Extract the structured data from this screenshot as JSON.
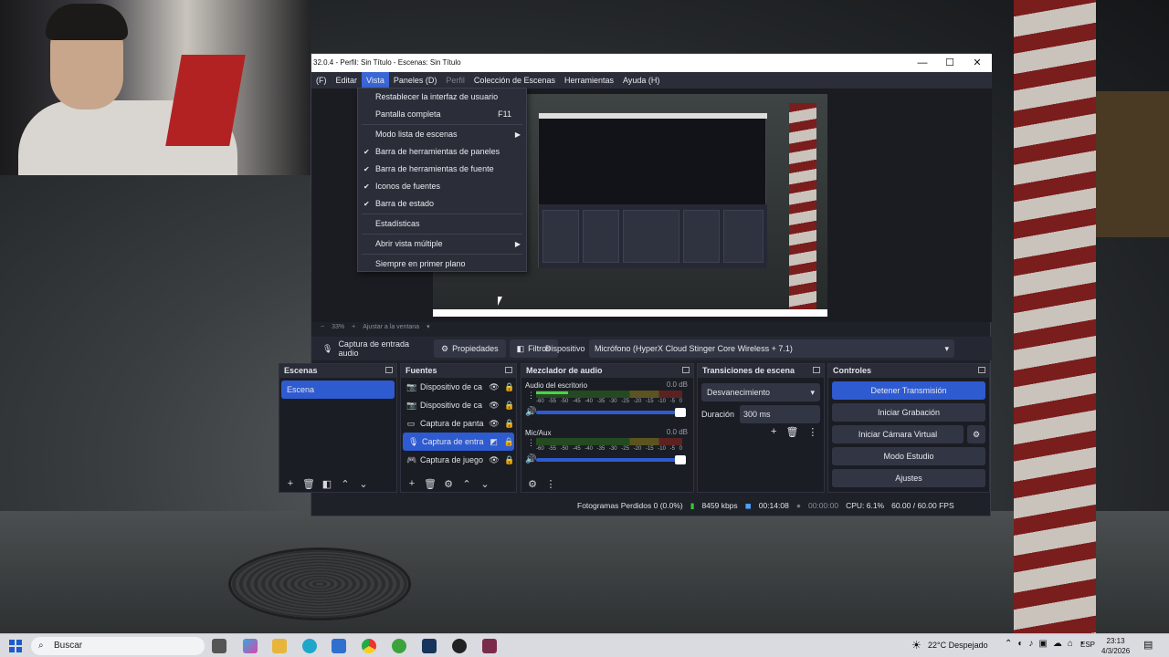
{
  "window": {
    "title": "32.0.4 - Perfil: Sin Título - Escenas: Sin Título",
    "min": "—",
    "max": "☐",
    "close": "✕"
  },
  "menubar": {
    "items": [
      "(F)",
      "Editar",
      "Vista",
      "Paneles (D)",
      "Perfil",
      "Colección de Escenas",
      "Herramientas",
      "Ayuda (H)"
    ],
    "active": "Vista"
  },
  "vista_menu": {
    "items": [
      {
        "label": "Restablecer la interfaz de usuario",
        "shortcut": "",
        "checked": false
      },
      {
        "label": "Pantalla completa",
        "shortcut": "F11",
        "checked": false
      },
      {
        "label": "Modo lista de escenas",
        "submenu": true
      },
      {
        "label": "Barra de herramientas de paneles",
        "checked": true
      },
      {
        "label": "Barra de herramientas de fuente",
        "checked": true
      },
      {
        "label": "Iconos de fuentes",
        "checked": true
      },
      {
        "label": "Barra de estado",
        "checked": true
      },
      {
        "label": "Estadísticas"
      },
      {
        "label": "Abrir vista múltiple",
        "submenu": true
      },
      {
        "label": "Siempre en primer plano"
      }
    ]
  },
  "zoom": {
    "minus": "−",
    "value": "33%",
    "plus": "+",
    "fit": "Ajustar a la ventana"
  },
  "propbar": {
    "source": "Captura de entrada audio",
    "properties": "Propiedades",
    "filters": "Filtros",
    "device_label": "Dispositivo",
    "device_value": "Micrófono (HyperX Cloud Stinger Core Wireless + 7.1)"
  },
  "scenes": {
    "title": "Escenas",
    "items": [
      "Escena"
    ]
  },
  "sources": {
    "title": "Fuentes",
    "items": [
      {
        "name": "Dispositivo de ca",
        "icon": "📷"
      },
      {
        "name": "Dispositivo de ca",
        "icon": "📷"
      },
      {
        "name": "Captura de panta",
        "icon": "▭"
      },
      {
        "name": "Captura de entra",
        "icon": "🎙"
      },
      {
        "name": "Captura de juego",
        "icon": "🎮"
      }
    ]
  },
  "mixer": {
    "title": "Mezclador de audio",
    "channels": [
      {
        "name": "Audio del escritorio",
        "db": "0.0 dB",
        "level": 0.22
      },
      {
        "name": "Mic/Aux",
        "db": "0.0 dB",
        "level": 0.0
      }
    ],
    "ticks": [
      "-60",
      "-55",
      "-50",
      "-45",
      "-40",
      "-35",
      "-30",
      "-25",
      "-20",
      "-15",
      "-10",
      "-5",
      "0"
    ]
  },
  "transitions": {
    "title": "Transiciones de escena",
    "selected": "Desvanecimiento",
    "duration_label": "Duración",
    "duration_value": "300 ms"
  },
  "controls": {
    "title": "Controles",
    "buttons": [
      "Detener Transmisión",
      "Iniciar Grabación",
      "Iniciar Cámara Virtual",
      "Modo Estudio",
      "Ajustes"
    ]
  },
  "statusbar": {
    "dropped": "Fotogramas Perdidos 0 (0.0%)",
    "bitrate": "8459 kbps",
    "stream_time": "00:14:08",
    "rec_time": "00:00:00",
    "cpu": "CPU: 6.1%",
    "fps": "60.00 / 60.00 FPS"
  },
  "taskbar": {
    "search": "Buscar",
    "weather": "22°C  Despejado",
    "lang": "ESP",
    "time": "23:13",
    "date": "4/3/2026"
  },
  "colors": {
    "accent": "#2f5bd1",
    "obs_bg": "#1f2129"
  }
}
